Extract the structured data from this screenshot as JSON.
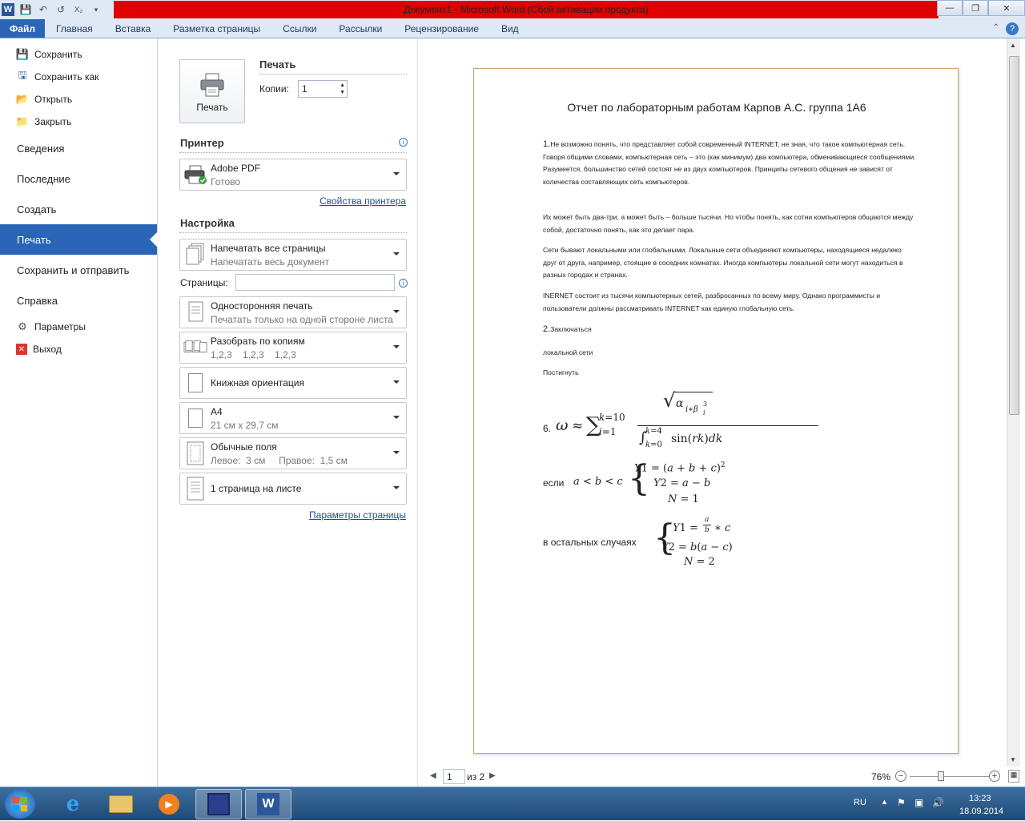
{
  "window": {
    "title": "Документ1  -  Microsoft Word (Сбой активации продукта)"
  },
  "ribbon": {
    "tabs": [
      "Файл",
      "Главная",
      "Вставка",
      "Разметка страницы",
      "Ссылки",
      "Рассылки",
      "Рецензирование",
      "Вид"
    ]
  },
  "menu": {
    "small_items": [
      {
        "label": "Сохранить",
        "icon": "save-icon"
      },
      {
        "label": "Сохранить как",
        "icon": "save-as-icon"
      },
      {
        "label": "Открыть",
        "icon": "open-folder-icon"
      },
      {
        "label": "Закрыть",
        "icon": "close-folder-icon"
      }
    ],
    "big_items": [
      "Сведения",
      "Последние",
      "Создать",
      "Печать",
      "Сохранить и отправить",
      "Справка"
    ],
    "active": "Печать",
    "bottom_items": [
      {
        "label": "Параметры",
        "icon": "options-icon"
      },
      {
        "label": "Выход",
        "icon": "exit-icon"
      }
    ]
  },
  "print": {
    "section_title": "Печать",
    "button_label": "Печать",
    "copies_label": "Копии:",
    "copies_value": "1",
    "printer_title": "Принтер",
    "printer_name": "Adobe PDF",
    "printer_status": "Готово",
    "printer_props_link": "Свойства принтера",
    "settings_title": "Настройка",
    "pages_label": "Страницы:",
    "pages_value": "",
    "page_setup_link": "Параметры страницы",
    "options": [
      {
        "main": "Напечатать все страницы",
        "sub": "Напечатать весь документ"
      },
      {
        "main": "Односторонняя печать",
        "sub": "Печатать только на одной стороне листа"
      },
      {
        "main": "Разобрать по копиям",
        "sub": "1,2,3    1,2,3    1,2,3"
      },
      {
        "main": "Книжная ориентация",
        "sub": ""
      },
      {
        "main": "A4",
        "sub": "21 см x 29,7 см"
      },
      {
        "main": "Обычные поля",
        "sub": "Левое:  3 см     Правое:  1,5 см"
      },
      {
        "main": "1 страница на листе",
        "sub": ""
      }
    ]
  },
  "document": {
    "title": "Отчет по лабораторным работам Карпов А.С. группа 1А6",
    "p1_num": "1.",
    "p1": "Не возможно понять, что представляет собой современный INTERNET,  не зная, что такое компьютерная  сеть. Говоря общими  словами, компьютерная  сеть – это (как  минимум) два компьютера, обменивающиеся сообщениями.  Разумеется, большинство сетей состоят не из двух компьютеров.  Принципы сетевого общения не зависят от количества составляющих  сеть компьютеров.",
    "p2": "Их может быть два-три,  а может быть – больше тысячи.  Но чтобы понять, как сотни компьютеров общаются между собой, достаточно понять, как это делает пара.",
    "p3": "Сети бывают  локальными  или глобальными.  Локальные сети объединяют компьютеры, находящиеся недалеко друг от друга, например, стоящие  в соседних комнатах.  Иногда компьютеры локальной сети могут находиться в разных городах и странах.",
    "p4": "INERNET состоит из тысячи компьютерных сетей, разбросанных по всему миру.  Однако программисты  и пользователи должны рассматривать INTERNET   как единую глобальную сеть.",
    "p5_num": "2.",
    "p5": "Заключаться",
    "p6": "локальной сети",
    "p7": "Постигнуть",
    "formula_num": "6.",
    "cond1_prefix": "если",
    "cond2_prefix": "в остальных случаях"
  },
  "nav": {
    "current_page": "1",
    "of_pages": "из 2",
    "zoom": "76%"
  },
  "tray": {
    "lang": "RU",
    "time": "13:23",
    "date": "18.09.2014"
  }
}
